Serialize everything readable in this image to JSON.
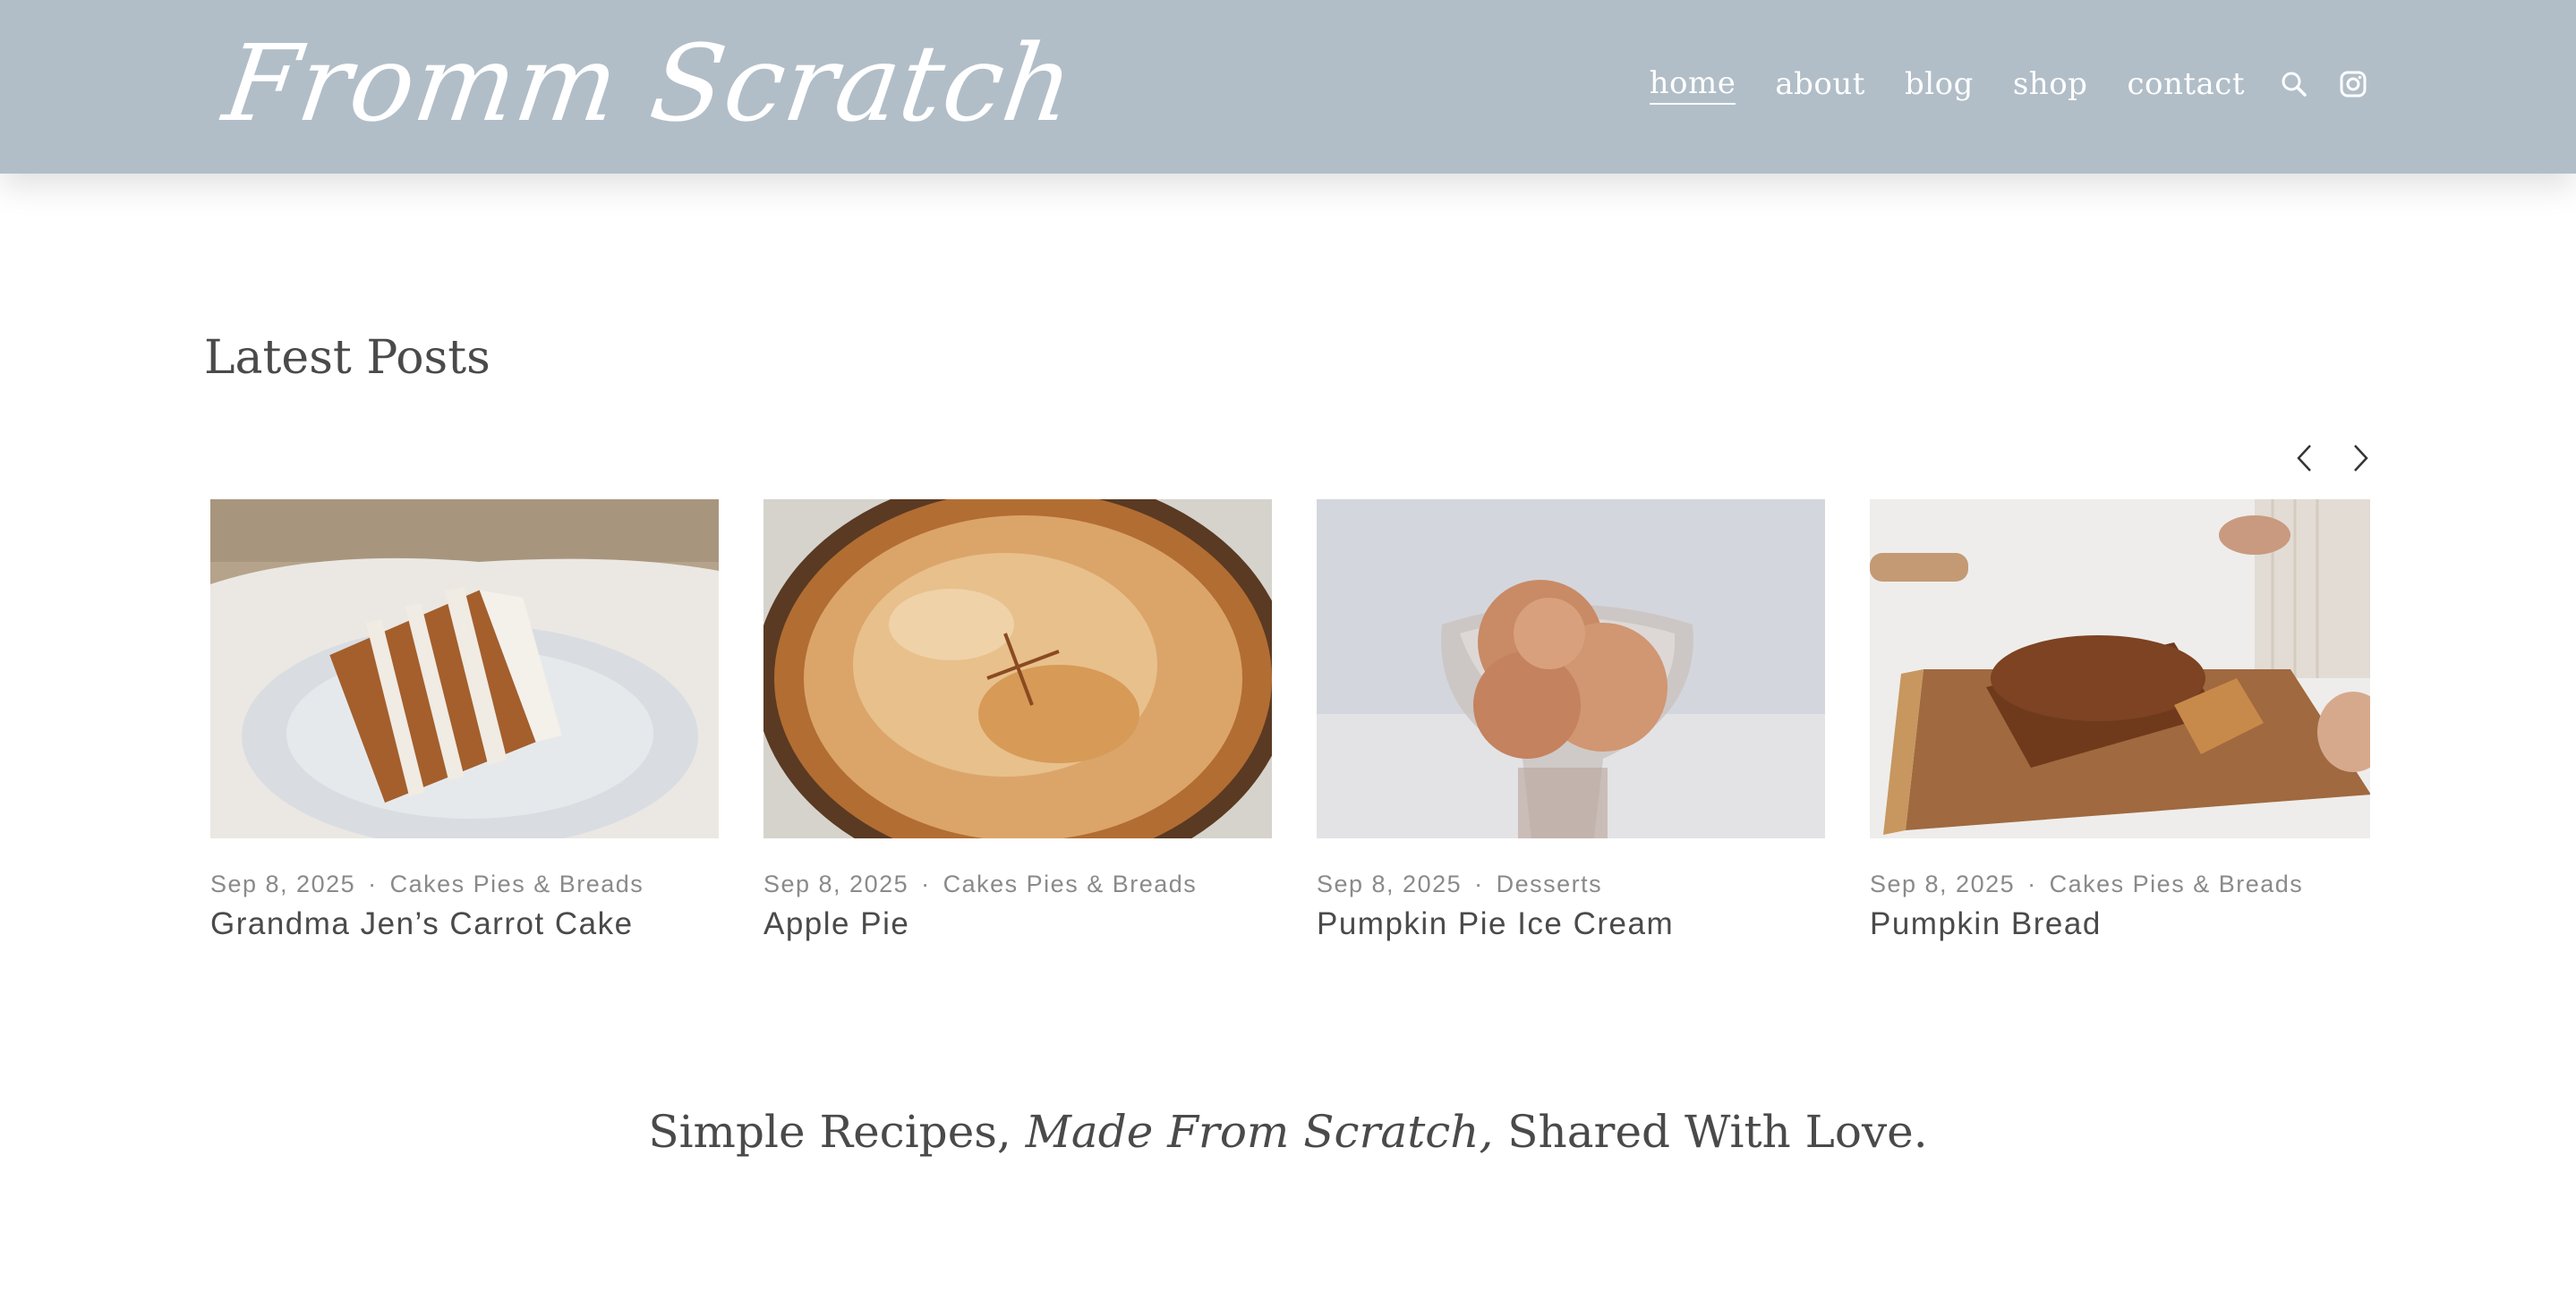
{
  "header": {
    "logo": "Fromm Scratch",
    "nav": [
      "home",
      "about",
      "blog",
      "shop",
      "contact"
    ],
    "active_nav": "home",
    "icons": [
      "search-icon",
      "instagram-icon"
    ],
    "background_color": "#b1bec8"
  },
  "latest_posts": {
    "title": "Latest Posts",
    "arrows": [
      "chevron-left-icon",
      "chevron-right-icon"
    ],
    "posts": [
      {
        "date": "Sep 8, 2025",
        "category": "Cakes Pies & Breads",
        "title": "Grandma Jen’s Carrot Cake",
        "image": "carrot cake slice on white plate"
      },
      {
        "date": "Sep 8, 2025",
        "category": "Cakes Pies & Breads",
        "title": "Apple Pie",
        "image": "apple pie with golden crust"
      },
      {
        "date": "Sep 8, 2025",
        "category": "Desserts",
        "title": "Pumpkin Pie Ice Cream",
        "image": "scoops of ice cream in glass dish"
      },
      {
        "date": "Sep 8, 2025",
        "category": "Cakes Pies & Breads",
        "title": "Pumpkin Bread",
        "image": "pumpkin bread loaf on cutting board"
      }
    ],
    "separator": "·"
  },
  "tagline": {
    "before": "Simple Recipes, ",
    "emphasis": "Made From Scratch,",
    "after": " Shared With Love."
  }
}
